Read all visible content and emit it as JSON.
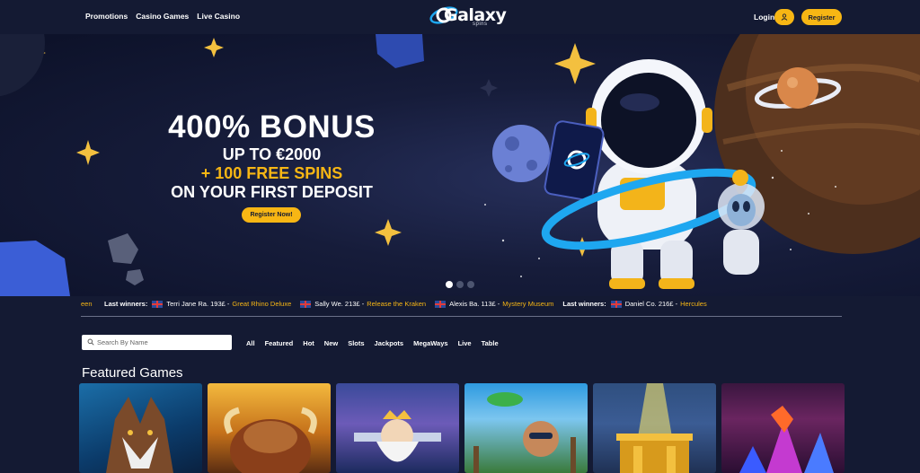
{
  "nav": {
    "items": [
      "Promotions",
      "Casino Games",
      "Live Casino"
    ]
  },
  "logo": {
    "word": "Galaxy",
    "sub": "spins"
  },
  "header": {
    "login_label": "Login",
    "register_label": "Register",
    "user_icon": "user-icon"
  },
  "hero": {
    "title": "400% BONUS",
    "line1": "UP TO €2000",
    "line2": "+ 100 FREE SPINS",
    "line3": "ON YOUR FIRST DEPOSIT",
    "cta": "Register Now!",
    "slides": 3,
    "active_slide": 1
  },
  "ticker": {
    "lead": "een",
    "items": [
      {
        "label": "Last winners:",
        "name": "Terri Jane Ra.",
        "amount": "193£",
        "game": "Great Rhino Deluxe"
      },
      {
        "label": "",
        "name": "Sally We.",
        "amount": "213£",
        "game": "Release the Kraken"
      },
      {
        "label": "",
        "name": "Alexis Ba.",
        "amount": "113£",
        "game": "Mystery Museum"
      },
      {
        "label": "Last winners:",
        "name": "Daniel Co.",
        "amount": "216£",
        "game": "Hercules"
      }
    ]
  },
  "search": {
    "placeholder": "Search By Name"
  },
  "filters": [
    "All",
    "Featured",
    "Hot",
    "New",
    "Slots",
    "Jackpots",
    "MegaWays",
    "Live",
    "Table"
  ],
  "featured": {
    "title": "Featured Games",
    "tiles": 6
  },
  "colors": {
    "background": "#141a33",
    "accent": "#f7b614",
    "orbit": "#1ea7f0"
  }
}
